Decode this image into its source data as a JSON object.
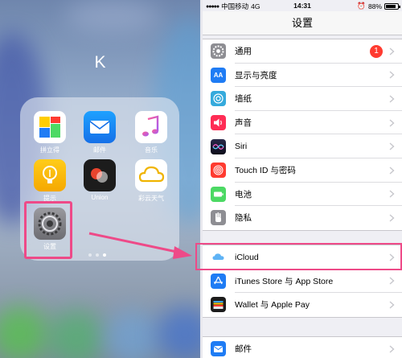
{
  "home": {
    "folder_title": "K",
    "apps": [
      {
        "name": "拼立得",
        "icon": "collage-icon",
        "color": "#ffffff"
      },
      {
        "name": "邮件",
        "icon": "mail-icon",
        "color": "#1e7cf5"
      },
      {
        "name": "音乐",
        "icon": "music-note-icon",
        "color": "#ffffff"
      },
      {
        "name": "提示",
        "icon": "lightbulb-icon",
        "color": "#f5b400"
      },
      {
        "name": "Union",
        "icon": "union-icon",
        "color": "#1c1c1c"
      },
      {
        "name": "彩云天气",
        "icon": "cloud-icon",
        "color": "#ffffff"
      },
      {
        "name": "设置",
        "icon": "gear-icon",
        "color": "#8e8e93"
      }
    ],
    "page_dots": 3,
    "active_page": 2
  },
  "status_bar": {
    "carrier": "中国移动",
    "network": "4G",
    "time": "14:31",
    "battery": "88%",
    "battery_level": 0.88
  },
  "settings": {
    "title": "设置",
    "groups": [
      {
        "rows": [
          {
            "label": "通用",
            "icon": "gear-icon",
            "color": "#8e8e93",
            "badge": "1"
          },
          {
            "label": "显示与亮度",
            "icon": "text-size-icon",
            "color": "#1f7cf4"
          },
          {
            "label": "墙纸",
            "icon": "flower-icon",
            "color": "#35aadc"
          },
          {
            "label": "声音",
            "icon": "speaker-icon",
            "color": "#ff2d55"
          },
          {
            "label": "Siri",
            "icon": "siri-icon",
            "color": "#1a1a2e"
          },
          {
            "label": "Touch ID 与密码",
            "icon": "fingerprint-icon",
            "color": "#ff3b30"
          },
          {
            "label": "电池",
            "icon": "battery-icon",
            "color": "#4cd964"
          },
          {
            "label": "隐私",
            "icon": "hand-icon",
            "color": "#8e8e93"
          }
        ]
      },
      {
        "rows": [
          {
            "label": "iCloud",
            "icon": "icloud-icon",
            "color": "#ffffff"
          },
          {
            "label": "iTunes Store 与 App Store",
            "icon": "app-store-icon",
            "color": "#1f7cf4"
          },
          {
            "label": "Wallet 与 Apple Pay",
            "icon": "wallet-icon",
            "color": "#1c1c1c"
          }
        ]
      },
      {
        "rows": [
          {
            "label": "邮件",
            "icon": "mail-icon",
            "color": "#1f7cf4"
          }
        ]
      }
    ]
  },
  "annotation_color": "#ee4a88"
}
